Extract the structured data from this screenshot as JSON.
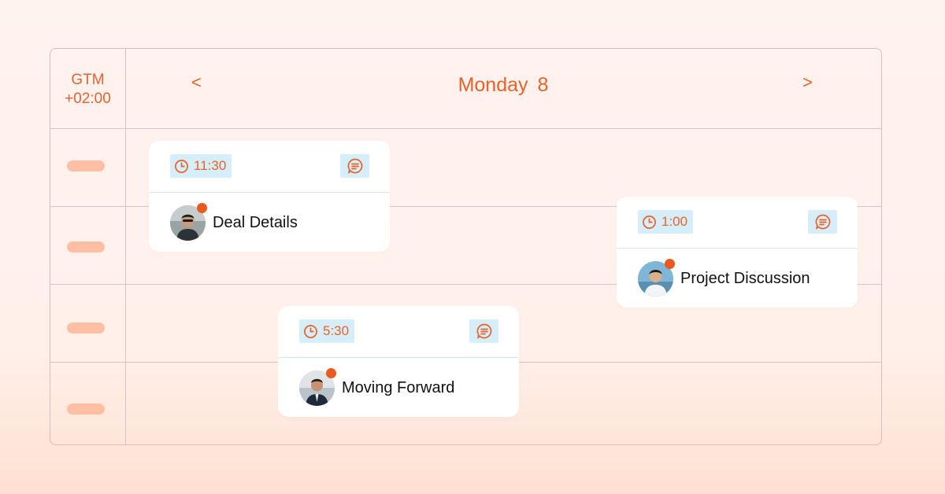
{
  "timezone": {
    "line1": "GTM",
    "line2": "+02:00"
  },
  "header": {
    "prev": "<",
    "next": ">",
    "day": "Monday",
    "date": "8"
  },
  "colors": {
    "accent": "#e8622a",
    "chip_bg": "#d6eefa",
    "pill": "#ffbfa4",
    "dot": "#ea5a1f"
  },
  "events": [
    {
      "time": "11:30",
      "title": "Deal Details",
      "icon_time": "clock-icon",
      "icon_action": "chat-icon"
    },
    {
      "time": "1:00",
      "title": "Project Discussion",
      "icon_time": "clock-icon",
      "icon_action": "chat-icon"
    },
    {
      "time": "5:30",
      "title": "Moving Forward",
      "icon_time": "clock-icon",
      "icon_action": "chat-icon"
    }
  ]
}
